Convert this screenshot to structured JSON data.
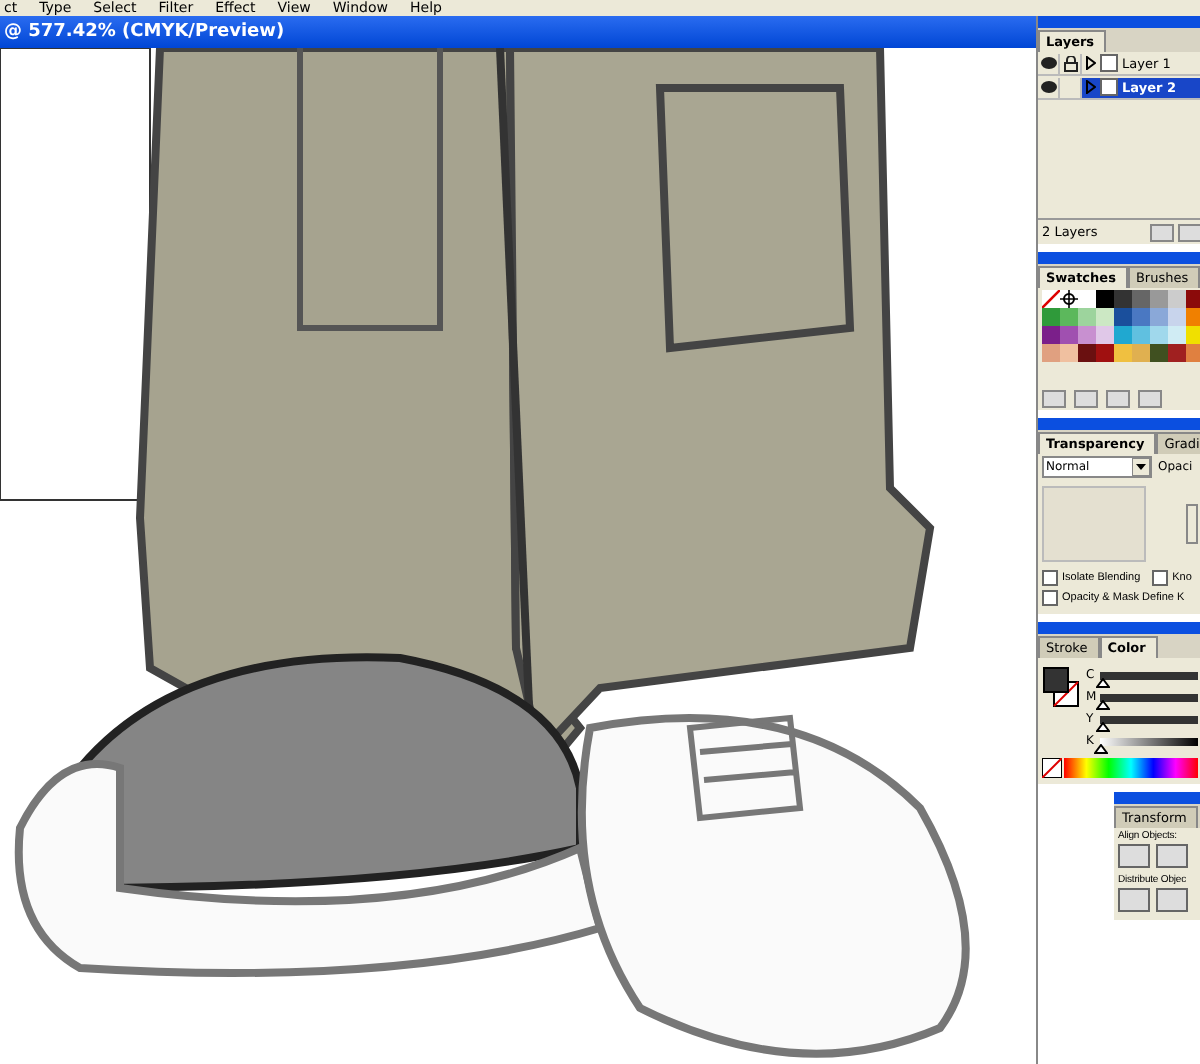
{
  "menu_bar": {
    "items": [
      "ct",
      "Type",
      "Select",
      "Filter",
      "Effect",
      "View",
      "Window",
      "Help"
    ]
  },
  "document": {
    "title": "@ 577.42% (CMYK/Preview)"
  },
  "layers_panel": {
    "tabs": [
      {
        "label": "Layers",
        "selected": true
      }
    ],
    "layers": [
      {
        "name": "Layer 1",
        "visible": true,
        "locked": true,
        "selected": false
      },
      {
        "name": "Layer 2",
        "visible": true,
        "locked": false,
        "selected": true
      }
    ],
    "count": "2 Layers"
  },
  "swatches_panel": {
    "tabs": [
      {
        "label": "Swatches",
        "selected": true
      },
      {
        "label": "Brushes",
        "selected": false
      }
    ],
    "swatches": [
      {
        "kind": "none"
      },
      {
        "kind": "registration"
      },
      {
        "kind": "color",
        "color": "#ffffff"
      },
      {
        "kind": "color",
        "color": "#000000"
      },
      {
        "kind": "color",
        "color": "#333333"
      },
      {
        "kind": "color",
        "color": "#666666"
      },
      {
        "kind": "color",
        "color": "#999999"
      },
      {
        "kind": "color",
        "color": "#cccccc"
      },
      {
        "kind": "color",
        "color": "#8b0a0a"
      },
      {
        "kind": "color",
        "color": "#2f9a3a"
      },
      {
        "kind": "color",
        "color": "#5cb85c"
      },
      {
        "kind": "color",
        "color": "#9dd49d"
      },
      {
        "kind": "color",
        "color": "#cce8c4"
      },
      {
        "kind": "color",
        "color": "#1a4f9c"
      },
      {
        "kind": "color",
        "color": "#4a78c2"
      },
      {
        "kind": "color",
        "color": "#8aa8d8"
      },
      {
        "kind": "color",
        "color": "#c8d4ec"
      },
      {
        "kind": "color",
        "color": "#f08000"
      },
      {
        "kind": "color",
        "color": "#7b1f8a"
      },
      {
        "kind": "color",
        "color": "#a050b0"
      },
      {
        "kind": "color",
        "color": "#c890d0"
      },
      {
        "kind": "color",
        "color": "#e0c8e8"
      },
      {
        "kind": "color",
        "color": "#20a8d0"
      },
      {
        "kind": "color",
        "color": "#60c0e0"
      },
      {
        "kind": "color",
        "color": "#a0d8ec"
      },
      {
        "kind": "color",
        "color": "#d0ecf4"
      },
      {
        "kind": "color",
        "color": "#f0e000"
      },
      {
        "kind": "color",
        "color": "#e0a080"
      },
      {
        "kind": "color",
        "color": "#f0c0a0"
      },
      {
        "kind": "color",
        "color": "#6a1010"
      },
      {
        "kind": "color",
        "color": "#a01010"
      },
      {
        "kind": "color",
        "color": "#f0c040"
      },
      {
        "kind": "color",
        "color": "#e0b050"
      },
      {
        "kind": "color",
        "color": "#405020"
      },
      {
        "kind": "color",
        "color": "#a02020"
      },
      {
        "kind": "color",
        "color": "#e08040"
      }
    ]
  },
  "transparency_panel": {
    "tabs": [
      {
        "label": "Transparency",
        "selected": true
      },
      {
        "label": "Gradi",
        "selected": false
      }
    ],
    "blend_mode": "Normal",
    "opacity_label": "Opaci",
    "options": [
      {
        "label": "Isolate Blending",
        "checked": false
      },
      {
        "label": "Kno",
        "checked": false
      },
      {
        "label": "Opacity & Mask Define K",
        "checked": false
      }
    ]
  },
  "color_panel": {
    "tabs": [
      {
        "label": "Stroke",
        "selected": false
      },
      {
        "label": "Color",
        "selected": true
      }
    ],
    "sliders": [
      {
        "label": "C",
        "level": 0.02
      },
      {
        "label": "M",
        "level": 0.02
      },
      {
        "label": "Y",
        "level": 0.02
      },
      {
        "label": "K",
        "level": 0.0
      }
    ]
  },
  "align_panel": {
    "tabs": [
      {
        "label": "Transform",
        "selected": false
      }
    ],
    "align_label": "Align Objects:",
    "distribute_label": "Distribute Objec"
  }
}
